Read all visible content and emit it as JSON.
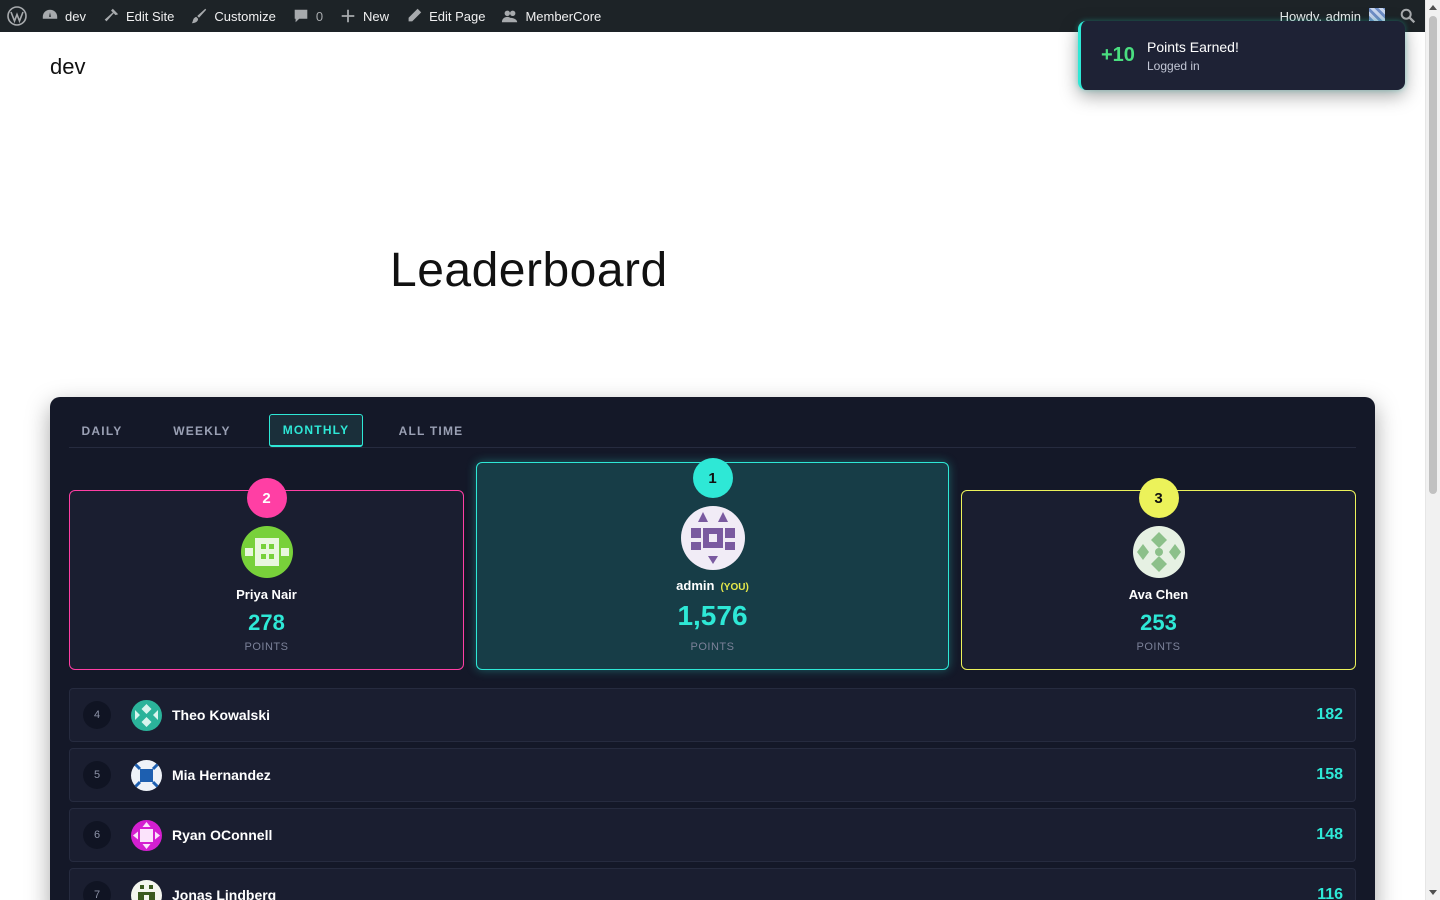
{
  "admin_bar": {
    "site_name": "dev",
    "edit_site": "Edit Site",
    "customize": "Customize",
    "comments_count": "0",
    "new": "New",
    "edit_page": "Edit Page",
    "membercore": "MemberCore",
    "howdy": "Howdy, admin"
  },
  "site": {
    "title": "dev"
  },
  "page": {
    "title": "Leaderboard"
  },
  "toast": {
    "points": "+10",
    "title": "Points Earned!",
    "subtitle": "Logged in"
  },
  "leaderboard": {
    "tabs": [
      "DAILY",
      "WEEKLY",
      "MONTHLY",
      "ALL TIME"
    ],
    "active_tab": "MONTHLY",
    "points_label": "POINTS",
    "you_label": "(YOU)",
    "podium": [
      {
        "rank": "2",
        "name": "Priya Nair",
        "score": "278",
        "color": "#ff3fa4"
      },
      {
        "rank": "1",
        "name": "admin",
        "score": "1,576",
        "color": "#2ee8d6"
      },
      {
        "rank": "3",
        "name": "Ava Chen",
        "score": "253",
        "color": "#ecf25a"
      }
    ],
    "rows": [
      {
        "rank": "4",
        "name": "Theo Kowalski",
        "score": "182"
      },
      {
        "rank": "5",
        "name": "Mia Hernandez",
        "score": "158"
      },
      {
        "rank": "6",
        "name": "Ryan OConnell",
        "score": "148"
      },
      {
        "rank": "7",
        "name": "Jonas Lindberg",
        "score": "116"
      }
    ]
  },
  "colors": {
    "accent": "#2ee8d6",
    "panel": "#141828",
    "card": "#1a1e30",
    "adminbar": "#1d2327",
    "toast_points": "#4ade80"
  }
}
